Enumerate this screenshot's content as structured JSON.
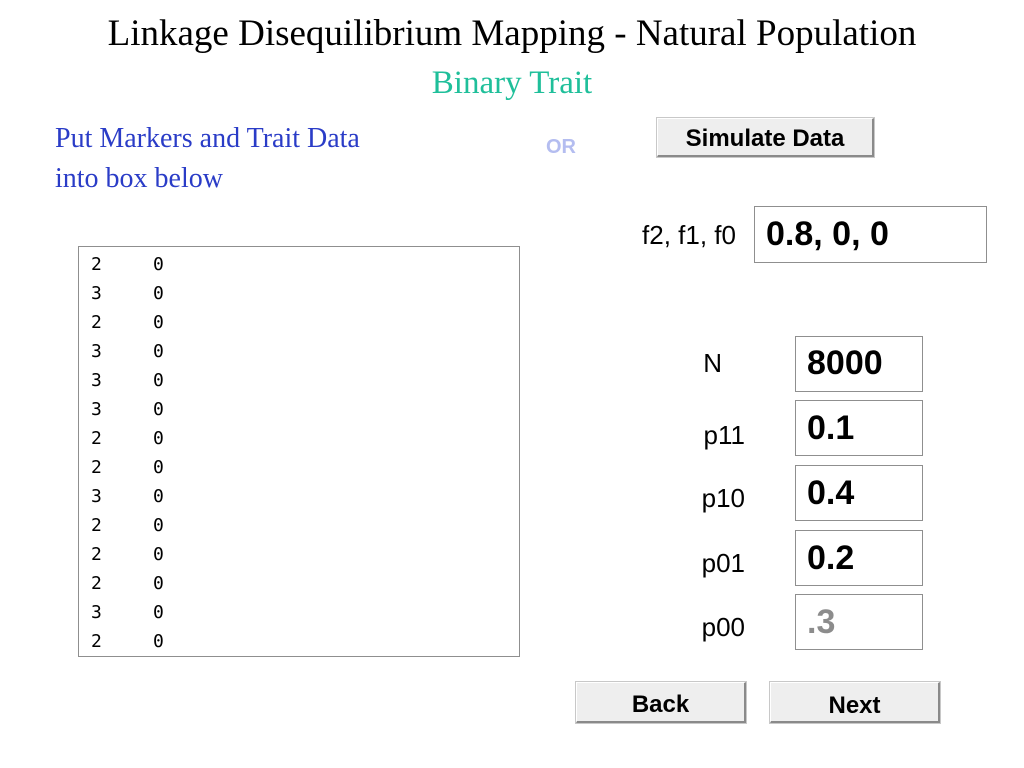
{
  "header": {
    "title": "Linkage Disequilibrium Mapping - Natural Population",
    "subtitle": "Binary Trait"
  },
  "input_panel": {
    "instructions_line1": "Put Markers and Trait Data",
    "instructions_line2": "into box below",
    "data_rows": [
      [
        "2",
        "0"
      ],
      [
        "3",
        "0"
      ],
      [
        "2",
        "0"
      ],
      [
        "3",
        "0"
      ],
      [
        "3",
        "0"
      ],
      [
        "3",
        "0"
      ],
      [
        "2",
        "0"
      ],
      [
        "2",
        "0"
      ],
      [
        "3",
        "0"
      ],
      [
        "2",
        "0"
      ],
      [
        "2",
        "0"
      ],
      [
        "2",
        "0"
      ],
      [
        "3",
        "0"
      ],
      [
        "2",
        "0"
      ]
    ]
  },
  "or_label": "OR",
  "simulate": {
    "button_label": "Simulate Data",
    "freq_label": "f2, f1, f0",
    "freq_value": "0.8, 0, 0"
  },
  "parameters": {
    "n_label": "N",
    "n_value": "8000",
    "p11_label": "p11",
    "p11_value": "0.1",
    "p10_label": "p10",
    "p10_value": "0.4",
    "p01_label": "p01",
    "p01_value": "0.2",
    "p00_label": "p00",
    "p00_value": ".3"
  },
  "navigation": {
    "back_label": "Back",
    "next_label": "Next"
  }
}
